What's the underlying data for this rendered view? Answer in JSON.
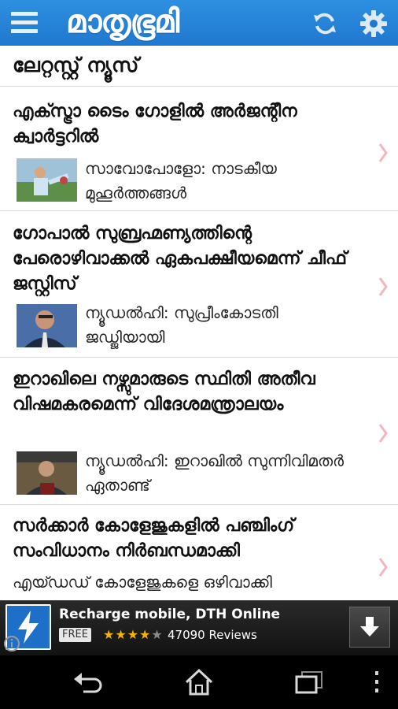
{
  "header": {
    "logo_text": "മാതൃഭൂമി",
    "bar_color": "#1f78cf"
  },
  "section": {
    "title": "ലേറ്റസ്റ്റ് ന്യൂസ്"
  },
  "news": [
    {
      "headline": "എക്സ്ട്രാ ടൈം ഗോളിൽ അർജന്റീന ക്വാർട്ടറിൽ",
      "summary": "സാവോപോളോ: നാടകീയ മുഹൂർത്തങ്ങൾ",
      "has_thumbnail": true
    },
    {
      "headline": "ഗോപാൽ സുബ്രഹ്മണ്യത്തിന്റെ പേരൊഴിവാക്കൽ ഏകപക്ഷീയമെന്ന് ചീഫ് ജസ്റ്റിസ്",
      "summary": "ന്യൂഡൽഹി: സുപ്രീംകോടതി ജഡ്ജിയായി",
      "has_thumbnail": true
    },
    {
      "headline": "ഇറാഖിലെ നഴ്സുമാരുടെ സ്ഥിതി അതീവ വിഷമകരമെന്ന് വിദേശമന്ത്രാലയം",
      "summary": "ന്യൂഡൽഹി: ഇറാഖിൽ സുന്നിവിമതർ ഏതാണ്ട്",
      "has_thumbnail": true
    },
    {
      "headline": "സർക്കാർ കോളേജുകളിൽ പഞ്ചിംഗ് സംവിധാനം നിർബന്ധമാക്കി",
      "summary": "എയ്ഡഡ് കോളേജുകളെ ഒഴിവാക്കി",
      "has_thumbnail": false
    }
  ],
  "ad": {
    "title": "Recharge mobile, DTH Online",
    "free_badge": "FREE",
    "rating_stars": 4,
    "reviews": "47090 Reviews"
  },
  "colors": {
    "chevron": "#f2b6bf",
    "star": "#f2b400"
  }
}
